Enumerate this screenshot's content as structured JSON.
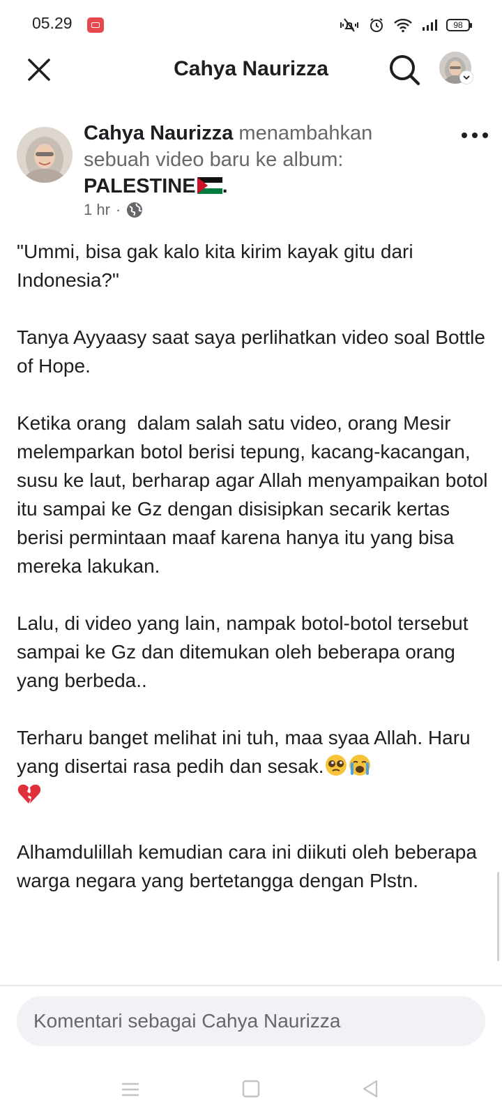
{
  "status_bar": {
    "time": "05.29",
    "battery": "98",
    "icons": [
      "screen-record-icon",
      "mute-vibrate-icon",
      "alarm-icon",
      "wifi-icon",
      "signal-icon",
      "battery-icon"
    ]
  },
  "top_bar": {
    "title": "Cahya Naurizza",
    "icons": [
      "close-icon",
      "search-icon",
      "profile-avatar"
    ]
  },
  "post": {
    "author": "Cahya Naurizza",
    "action": " menambahkan sebuah video baru ke album: ",
    "album": "PALESTINE",
    "album_suffix": ".",
    "time": "1 hr",
    "separator": "·",
    "privacy_icon": "globe-icon",
    "paragraphs": [
      "\"Ummi, bisa gak kalo kita kirim kayak gitu dari Indonesia?\"",
      "Tanya Ayyaasy saat saya perlihatkan video soal Bottle of Hope.",
      "Ketika orang  dalam salah satu video, orang Mesir melemparkan botol berisi tepung, kacang-kacangan, susu ke laut, berharap agar Allah menyampaikan botol itu sampai ke Gz dengan disisipkan secarik kertas berisi permintaan maaf karena hanya itu yang bisa mereka lakukan.",
      "Lalu, di video yang lain, nampak botol-botol tersebut sampai ke Gz dan ditemukan oleh beberapa orang yang berbeda..",
      "Terharu banget melihat ini tuh, maa syaa Allah. Haru yang disertai rasa pedih dan sesak.",
      "Alhamdulillah kemudian cara ini diikuti oleh beberapa warga negara yang bertetangga dengan Plstn."
    ],
    "emojis": [
      "pleading-face-emoji",
      "crying-face-emoji",
      "broken-heart-emoji"
    ]
  },
  "comment": {
    "placeholder": "Komentari sebagai Cahya Naurizza"
  },
  "nav": {
    "icons": [
      "menu-icon",
      "home-square-icon",
      "back-triangle-icon"
    ]
  },
  "colors": {
    "text": "#1c1e21",
    "secondary_text": "#65676b",
    "comment_bg": "#f0f2f5",
    "flag_red": "#ce1126",
    "flag_green": "#007a3d"
  }
}
